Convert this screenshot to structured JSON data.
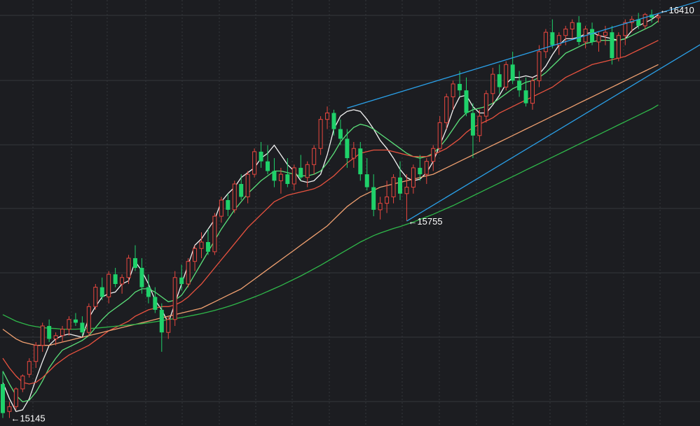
{
  "chart_data": {
    "type": "candlestick",
    "title": "",
    "xlabel": "",
    "ylabel": "",
    "grid": true,
    "ylim": [
      15120,
      16440
    ],
    "colors": {
      "background": "#1c1d21",
      "grid": "#34363c",
      "up": "#e8473f",
      "down": "#1fd16a",
      "trendline": "#2aa0e8"
    },
    "annotations": [
      {
        "label": "←16410",
        "value": 16410,
        "index": 99
      },
      {
        "label": "←15755",
        "value": 15755,
        "index": 61
      },
      {
        "label": "←15145",
        "value": 15145,
        "index": 1
      }
    ],
    "trendlines": [
      {
        "from": [
          52,
          16105
        ],
        "to": [
          106,
          16442
        ]
      },
      {
        "from": [
          61,
          15755
        ],
        "to": [
          106,
          16310
        ]
      }
    ],
    "moving_averages": [
      {
        "color": "#f2f2f2",
        "values": [
          15255,
          15205,
          15165,
          15170,
          15205,
          15265,
          15320,
          15370,
          15390,
          15400,
          15405,
          15400,
          15395,
          15455,
          15490,
          15520,
          15530,
          15535,
          15560,
          15570,
          15630,
          15600,
          15560,
          15510,
          15480,
          15440,
          15500,
          15560,
          15620,
          15680,
          15700,
          15730,
          15760,
          15815,
          15840,
          15860,
          15890,
          15905,
          15920,
          15950,
          15965,
          15990,
          15960,
          15930,
          15910,
          15880,
          15875,
          15880,
          15900,
          15960,
          16040,
          16080,
          16095,
          16100,
          16095,
          16070,
          16040,
          16005,
          15980,
          15950,
          15915,
          15890,
          15880,
          15885,
          15905,
          15940,
          15990,
          16040,
          16100,
          16140,
          16145,
          16110,
          16090,
          16090,
          16115,
          16145,
          16180,
          16200,
          16200,
          16205,
          16200,
          16210,
          16235,
          16270,
          16300,
          16320,
          16320,
          16325,
          16335,
          16340,
          16330,
          16325,
          16320,
          16315,
          16320,
          16345,
          16360,
          16370,
          16380,
          16395
        ]
      },
      {
        "color": "#5be07a",
        "values": [
          15290,
          15250,
          15215,
          15195,
          15200,
          15225,
          15260,
          15300,
          15330,
          15355,
          15365,
          15375,
          15385,
          15400,
          15425,
          15450,
          15470,
          15485,
          15500,
          15515,
          15535,
          15545,
          15545,
          15535,
          15520,
          15505,
          15510,
          15525,
          15555,
          15590,
          15625,
          15660,
          15695,
          15730,
          15760,
          15790,
          15815,
          15840,
          15860,
          15880,
          15895,
          15910,
          15910,
          15905,
          15900,
          15895,
          15895,
          15900,
          15910,
          15935,
          15965,
          16000,
          16025,
          16045,
          16055,
          16050,
          16040,
          16025,
          16010,
          15995,
          15980,
          15965,
          15955,
          15950,
          15955,
          15965,
          15985,
          16010,
          16040,
          16070,
          16090,
          16100,
          16105,
          16110,
          16120,
          16135,
          16150,
          16165,
          16175,
          16185,
          16190,
          16200,
          16215,
          16235,
          16255,
          16275,
          16285,
          16295,
          16305,
          16310,
          16315,
          16315,
          16315,
          16315,
          16320,
          16330,
          16340,
          16350,
          16360,
          16375
        ]
      },
      {
        "color": "#e8523f",
        "values": [
          15330,
          15300,
          15275,
          15255,
          15250,
          15255,
          15270,
          15290,
          15310,
          15325,
          15340,
          15350,
          15360,
          15370,
          15385,
          15400,
          15415,
          15425,
          15435,
          15445,
          15460,
          15470,
          15480,
          15485,
          15490,
          15490,
          15495,
          15505,
          15520,
          15540,
          15560,
          15585,
          15610,
          15635,
          15660,
          15685,
          15710,
          15735,
          15755,
          15775,
          15795,
          15815,
          15825,
          15835,
          15840,
          15845,
          15850,
          15855,
          15865,
          15880,
          15895,
          15915,
          15935,
          15950,
          15965,
          15970,
          15975,
          15975,
          15975,
          15970,
          15965,
          15960,
          15955,
          15955,
          15955,
          15960,
          15970,
          15980,
          15995,
          16010,
          16030,
          16045,
          16055,
          16065,
          16075,
          16090,
          16100,
          16110,
          16120,
          16130,
          16140,
          16150,
          16160,
          16170,
          16185,
          16200,
          16210,
          16220,
          16230,
          16240,
          16245,
          16250,
          16255,
          16260,
          16265,
          16275,
          16285,
          16295,
          16305,
          16315
        ]
      },
      {
        "color": "#f0a070",
        "values": [
          15420,
          15405,
          15390,
          15380,
          15375,
          15370,
          15370,
          15370,
          15375,
          15380,
          15385,
          15390,
          15395,
          15400,
          15405,
          15410,
          15415,
          15420,
          15425,
          15430,
          15435,
          15440,
          15445,
          15450,
          15455,
          15460,
          15465,
          15470,
          15475,
          15480,
          15485,
          15495,
          15505,
          15515,
          15525,
          15535,
          15545,
          15560,
          15575,
          15590,
          15605,
          15620,
          15635,
          15650,
          15665,
          15680,
          15695,
          15710,
          15725,
          15740,
          15760,
          15780,
          15800,
          15815,
          15830,
          15840,
          15850,
          15860,
          15865,
          15870,
          15875,
          15880,
          15885,
          15890,
          15895,
          15900,
          15910,
          15920,
          15930,
          15940,
          15950,
          15960,
          15970,
          15980,
          15990,
          16000,
          16010,
          16020,
          16030,
          16040,
          16050,
          16060,
          16070,
          16080,
          16090,
          16100,
          16110,
          16120,
          16130,
          16140,
          16150,
          16160,
          16170,
          16180,
          16190,
          16200,
          16210,
          16220,
          16230,
          16240
        ]
      },
      {
        "color": "#2fb84a",
        "values": [
          15465,
          15455,
          15445,
          15438,
          15432,
          15428,
          15425,
          15423,
          15422,
          15420,
          15420,
          15420,
          15421,
          15422,
          15423,
          15425,
          15427,
          15429,
          15431,
          15433,
          15435,
          15437,
          15440,
          15443,
          15446,
          15450,
          15453,
          15456,
          15460,
          15464,
          15468,
          15473,
          15478,
          15484,
          15490,
          15497,
          15504,
          15512,
          15520,
          15528,
          15537,
          15546,
          15555,
          15565,
          15575,
          15585,
          15596,
          15607,
          15618,
          15630,
          15642,
          15654,
          15666,
          15678,
          15690,
          15700,
          15710,
          15718,
          15725,
          15732,
          15738,
          15745,
          15752,
          15760,
          15768,
          15776,
          15785,
          15794,
          15803,
          15813,
          15823,
          15833,
          15843,
          15853,
          15863,
          15873,
          15883,
          15893,
          15903,
          15913,
          15923,
          15933,
          15943,
          15953,
          15963,
          15973,
          15983,
          15993,
          16003,
          16013,
          16023,
          16033,
          16043,
          16053,
          16063,
          16073,
          16083,
          16093,
          16103,
          16115
        ]
      }
    ],
    "ohlc": [
      [
        15250,
        15290,
        15145,
        15160
      ],
      [
        15165,
        15195,
        15145,
        15180
      ],
      [
        15180,
        15240,
        15170,
        15235
      ],
      [
        15235,
        15280,
        15225,
        15275
      ],
      [
        15280,
        15330,
        15270,
        15320
      ],
      [
        15320,
        15380,
        15300,
        15370
      ],
      [
        15370,
        15440,
        15350,
        15430
      ],
      [
        15430,
        15450,
        15380,
        15390
      ],
      [
        15390,
        15410,
        15370,
        15400
      ],
      [
        15400,
        15430,
        15380,
        15420
      ],
      [
        15420,
        15460,
        15400,
        15450
      ],
      [
        15450,
        15470,
        15430,
        15440
      ],
      [
        15440,
        15460,
        15400,
        15410
      ],
      [
        15410,
        15500,
        15400,
        15490
      ],
      [
        15490,
        15560,
        15480,
        15550
      ],
      [
        15550,
        15580,
        15510,
        15520
      ],
      [
        15520,
        15600,
        15500,
        15590
      ],
      [
        15590,
        15610,
        15550,
        15560
      ],
      [
        15560,
        15590,
        15530,
        15580
      ],
      [
        15580,
        15650,
        15560,
        15640
      ],
      [
        15640,
        15680,
        15600,
        15610
      ],
      [
        15610,
        15640,
        15530,
        15550
      ],
      [
        15550,
        15590,
        15500,
        15520
      ],
      [
        15520,
        15550,
        15470,
        15480
      ],
      [
        15480,
        15500,
        15350,
        15410
      ],
      [
        15410,
        15460,
        15390,
        15450
      ],
      [
        15450,
        15600,
        15430,
        15580
      ],
      [
        15580,
        15620,
        15540,
        15560
      ],
      [
        15560,
        15640,
        15550,
        15630
      ],
      [
        15630,
        15680,
        15600,
        15670
      ],
      [
        15670,
        15720,
        15640,
        15690
      ],
      [
        15690,
        15730,
        15650,
        15660
      ],
      [
        15660,
        15780,
        15650,
        15770
      ],
      [
        15770,
        15830,
        15750,
        15820
      ],
      [
        15820,
        15840,
        15770,
        15790
      ],
      [
        15790,
        15880,
        15780,
        15870
      ],
      [
        15870,
        15900,
        15820,
        15830
      ],
      [
        15830,
        15910,
        15810,
        15900
      ],
      [
        15900,
        15980,
        15890,
        15970
      ],
      [
        15970,
        16000,
        15920,
        15940
      ],
      [
        15940,
        15990,
        15900,
        15910
      ],
      [
        15910,
        15950,
        15860,
        15880
      ],
      [
        15880,
        15920,
        15840,
        15900
      ],
      [
        15900,
        15950,
        15860,
        15870
      ],
      [
        15870,
        15930,
        15850,
        15920
      ],
      [
        15920,
        15960,
        15880,
        15890
      ],
      [
        15890,
        15940,
        15860,
        15930
      ],
      [
        15930,
        15990,
        15900,
        15980
      ],
      [
        15980,
        16080,
        15960,
        16070
      ],
      [
        16070,
        16110,
        16040,
        16090
      ],
      [
        16090,
        16100,
        16020,
        16040
      ],
      [
        16040,
        16070,
        15990,
        16010
      ],
      [
        16010,
        16040,
        15920,
        15950
      ],
      [
        15950,
        16000,
        15920,
        15980
      ],
      [
        15980,
        16000,
        15880,
        15900
      ],
      [
        15900,
        15950,
        15850,
        15860
      ],
      [
        15860,
        15900,
        15770,
        15790
      ],
      [
        15790,
        15830,
        15760,
        15810
      ],
      [
        15810,
        15880,
        15780,
        15830
      ],
      [
        15830,
        15900,
        15810,
        15890
      ],
      [
        15890,
        15940,
        15820,
        15840
      ],
      [
        15840,
        15900,
        15755,
        15860
      ],
      [
        15860,
        15930,
        15840,
        15920
      ],
      [
        15920,
        15960,
        15880,
        15900
      ],
      [
        15900,
        15950,
        15870,
        15940
      ],
      [
        15940,
        15990,
        15910,
        15980
      ],
      [
        15980,
        16080,
        15970,
        16060
      ],
      [
        16060,
        16150,
        16040,
        16140
      ],
      [
        16140,
        16190,
        16100,
        16180
      ],
      [
        16180,
        16220,
        16140,
        16160
      ],
      [
        16160,
        16200,
        16080,
        16090
      ],
      [
        16090,
        16120,
        15950,
        16020
      ],
      [
        16020,
        16100,
        16000,
        16080
      ],
      [
        16080,
        16160,
        16060,
        16150
      ],
      [
        16150,
        16230,
        16120,
        16210
      ],
      [
        16210,
        16240,
        16150,
        16170
      ],
      [
        16170,
        16250,
        16160,
        16240
      ],
      [
        16240,
        16280,
        16180,
        16190
      ],
      [
        16190,
        16220,
        16140,
        16160
      ],
      [
        16160,
        16200,
        16110,
        16120
      ],
      [
        16120,
        16200,
        16100,
        16190
      ],
      [
        16190,
        16300,
        16170,
        16280
      ],
      [
        16280,
        16350,
        16260,
        16340
      ],
      [
        16340,
        16380,
        16290,
        16300
      ],
      [
        16300,
        16340,
        16270,
        16330
      ],
      [
        16330,
        16360,
        16300,
        16350
      ],
      [
        16350,
        16380,
        16320,
        16370
      ],
      [
        16370,
        16390,
        16300,
        16310
      ],
      [
        16310,
        16360,
        16290,
        16350
      ],
      [
        16350,
        16370,
        16300,
        16310
      ],
      [
        16310,
        16340,
        16280,
        16330
      ],
      [
        16330,
        16360,
        16300,
        16340
      ],
      [
        16340,
        16360,
        16240,
        16260
      ],
      [
        16260,
        16340,
        16250,
        16330
      ],
      [
        16330,
        16380,
        16300,
        16370
      ],
      [
        16370,
        16390,
        16340,
        16380
      ],
      [
        16380,
        16400,
        16350,
        16360
      ],
      [
        16360,
        16400,
        16350,
        16395
      ],
      [
        16395,
        16410,
        16370,
        16385
      ],
      [
        16385,
        16400,
        16370,
        16390
      ]
    ]
  }
}
